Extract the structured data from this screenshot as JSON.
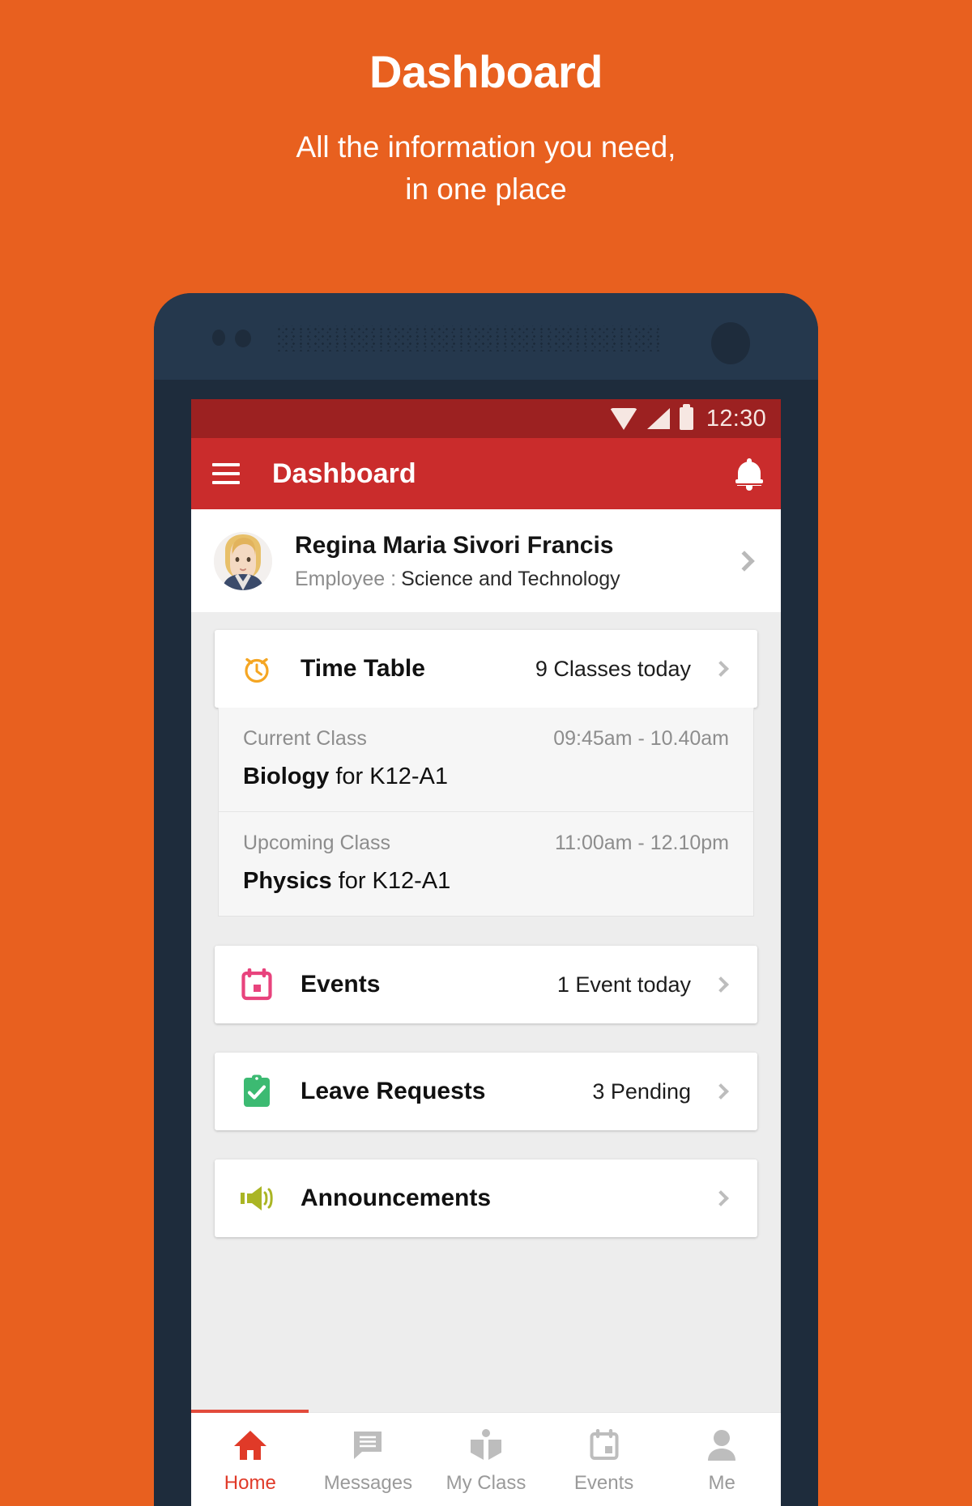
{
  "promo": {
    "title": "Dashboard",
    "subtitle_line1": "All the information you need,",
    "subtitle_line2": "in one place"
  },
  "colors": {
    "background": "#e8601f",
    "phone_frame": "#1e2c3c",
    "status_bar": "#9c2121",
    "app_bar": "#ca2c2c",
    "accent_red": "#e03a28",
    "icon_timetable": "#f5a623",
    "icon_events": "#e8437d",
    "icon_leave": "#3cba72",
    "icon_announcements": "#aab524"
  },
  "statusbar": {
    "time": "12:30",
    "wifi_icon": "wifi-icon",
    "signal_icon": "signal-icon",
    "battery_icon": "battery-icon"
  },
  "appbar": {
    "menu_icon": "hamburger-menu-icon",
    "title": "Dashboard",
    "notification_icon": "bell-icon"
  },
  "profile": {
    "avatar_icon": "user-avatar",
    "name": "Regina Maria Sivori Francis",
    "role_label": "Employee :",
    "department": "Science and Technology",
    "chevron_icon": "chevron-right-icon"
  },
  "cards": [
    {
      "key": "timetable",
      "icon": "alarm-clock-icon",
      "label": "Time Table",
      "meta": "9 Classes today"
    },
    {
      "key": "events",
      "icon": "calendar-icon",
      "label": "Events",
      "meta": "1 Event today"
    },
    {
      "key": "leave",
      "icon": "clipboard-check-icon",
      "label": "Leave Requests",
      "meta": "3 Pending"
    },
    {
      "key": "announcements",
      "icon": "megaphone-icon",
      "label": "Announcements",
      "meta": ""
    }
  ],
  "classes": [
    {
      "kind": "Current Class",
      "time": "09:45am - 10.40am",
      "subject": "Biology",
      "group": "for K12-A1"
    },
    {
      "kind": "Upcoming Class",
      "time": "11:00am - 12.10pm",
      "subject": "Physics",
      "group": "for K12-A1"
    }
  ],
  "bottomnav": [
    {
      "key": "home",
      "icon": "home-icon",
      "label": "Home",
      "active": true
    },
    {
      "key": "messages",
      "icon": "message-icon",
      "label": "Messages",
      "active": false
    },
    {
      "key": "myclass",
      "icon": "book-icon",
      "label": "My Class",
      "active": false
    },
    {
      "key": "events",
      "icon": "calendar-icon",
      "label": "Events",
      "active": false
    },
    {
      "key": "me",
      "icon": "person-icon",
      "label": "Me",
      "active": false
    }
  ]
}
